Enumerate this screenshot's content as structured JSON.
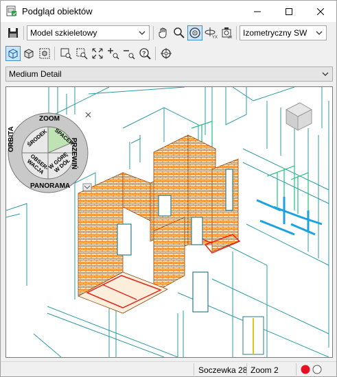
{
  "window": {
    "title": "Podgląd obiektów"
  },
  "toolbar": {
    "visual_style": "Model szkieletowy",
    "view_preset": "Izometryczny SW",
    "detail_level": "Medium Detail"
  },
  "wheel": {
    "zoom": "ZOOM",
    "orbita": "ORBITA",
    "przewin": "PRZEWIŃ",
    "panorama": "PANORAMA",
    "srodek": "ŚRODEK",
    "spacer": "SPACER",
    "obserwacja_1": "OBSER-",
    "obserwacja_2": "WACJA",
    "wgore_1": "W GÓRĘ",
    "wgore_2": "W DÓŁ"
  },
  "status": {
    "lens": "Soczewka 28",
    "zoom": "Zoom 2"
  },
  "colors": {
    "accent": "#3c8fd6",
    "brick": "#f07c1a",
    "wireframe": "#2a9aa5",
    "status_red": "#e81123"
  }
}
